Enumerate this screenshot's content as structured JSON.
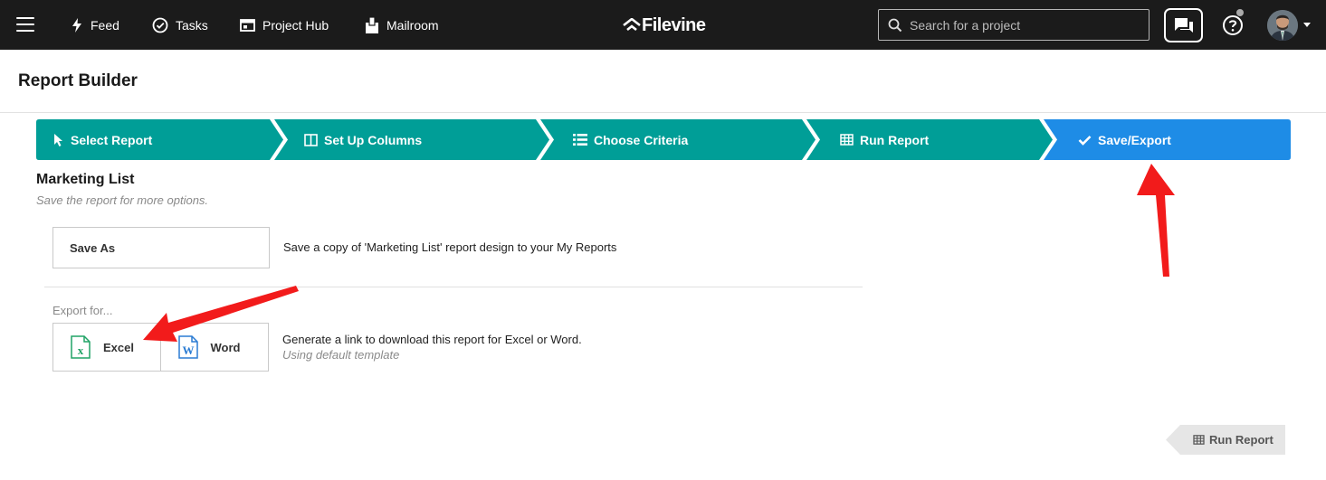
{
  "topbar": {
    "nav": [
      {
        "label": "Feed",
        "icon": "lightning-icon"
      },
      {
        "label": "Tasks",
        "icon": "check-circle-icon"
      },
      {
        "label": "Project Hub",
        "icon": "project-hub-icon"
      },
      {
        "label": "Mailroom",
        "icon": "mailroom-icon"
      }
    ],
    "logo_text": "Filevine",
    "search_placeholder": "Search for a project"
  },
  "page": {
    "title": "Report Builder"
  },
  "steps": [
    {
      "label": "Select Report",
      "icon": "cursor-icon",
      "state": "done"
    },
    {
      "label": "Set Up Columns",
      "icon": "columns-icon",
      "state": "done"
    },
    {
      "label": "Choose Criteria",
      "icon": "list-icon",
      "state": "done"
    },
    {
      "label": "Run Report",
      "icon": "table-icon",
      "state": "done"
    },
    {
      "label": "Save/Export",
      "icon": "checkmark-icon",
      "state": "active"
    }
  ],
  "report": {
    "name": "Marketing List",
    "subtitle": "Save the report for more options.",
    "save_as_label": "Save As",
    "save_as_description": "Save a copy of 'Marketing List' report design to your My Reports",
    "export_label": "Export for...",
    "export_excel_label": "Excel",
    "export_word_label": "Word",
    "export_description": "Generate a link to download this report for Excel or Word.",
    "export_sub": "Using default template"
  },
  "footer": {
    "run_report_label": "Run Report"
  },
  "colors": {
    "topbar": "#1b1b1b",
    "step_done": "#009e97",
    "step_active": "#1e8ce6",
    "annotation_arrow": "#f21b1b",
    "excel_green": "#21a366",
    "word_blue": "#2b7cd3"
  }
}
